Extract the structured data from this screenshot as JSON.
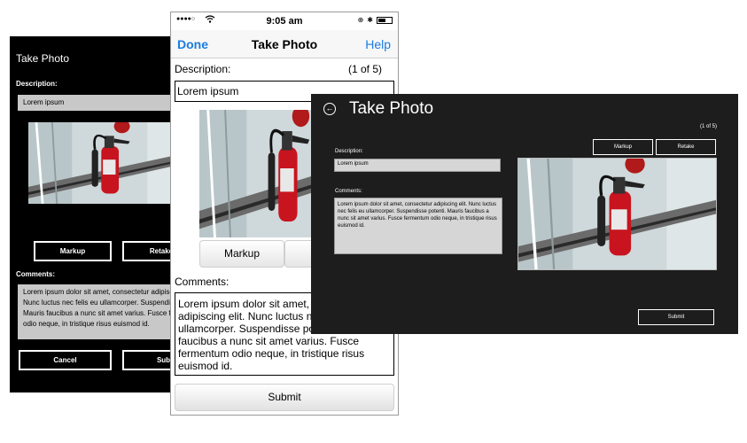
{
  "lorem_short": "Lorem ipsum",
  "windows_phone": {
    "title": "Take Photo",
    "description_label": "Description:",
    "description_value": "Lorem ipsum",
    "markup_label": "Markup",
    "retake_label": "Retake",
    "comments_label": "Comments:",
    "comments_lines": [
      "Lorem ipsum dolor sit amet, consectetur adipiscing",
      "Nunc luctus nec felis eu ullamcorper. Suspendisse",
      "Mauris faucibus a nunc sit amet varius. Fusce fe",
      "odio neque, in tristique risus euismod id."
    ],
    "cancel_label": "Cancel",
    "submit_label": "Submit"
  },
  "iphone": {
    "status_time": "9:05 am",
    "signal_dots": "●●●●○",
    "nav_left": "Done",
    "nav_title": "Take Photo",
    "nav_right": "Help",
    "description_label": "Description:",
    "counter": "(1 of 5)",
    "description_value": "Lorem ipsum",
    "markup_label": "Markup",
    "retake_label": "Retake",
    "comments_label": "Comments:",
    "comments_value": "Lorem ipsum dolor sit amet, consectetur adipiscing elit. Nunc luctus nec felis eu ullamcorper. Suspendisse potenti. Mauris faucibus a nunc sit amet varius. Fusce fermentum odio neque, in tristique risus euismod id.",
    "submit_label": "Submit"
  },
  "windows_app": {
    "title": "Take Photo",
    "counter": "(1 of 5)",
    "markup_label": "Markup",
    "retake_label": "Retake",
    "description_label": "Description:",
    "description_value": "Lorem ipsum",
    "comments_label": "Comments:",
    "comments_value": "Lorem ipsum dolor sit amet, consectetur adipiscing elit. Nunc luctus nec felis eu ullamcorper. Suspendisse potenti. Mauris faucibus a nunc sit amet varius. Fusce fermentum odio neque, in tristique risus euismod id.",
    "submit_label": "Submit"
  },
  "colors": {
    "ios_accent": "#1b7de0",
    "extinguisher_red": "#c8141e",
    "win_background": "#1d1d1d"
  },
  "icons": [
    "back-arrow-icon",
    "wifi-icon",
    "bluetooth-icon",
    "battery-icon",
    "lock-rotation-icon"
  ]
}
